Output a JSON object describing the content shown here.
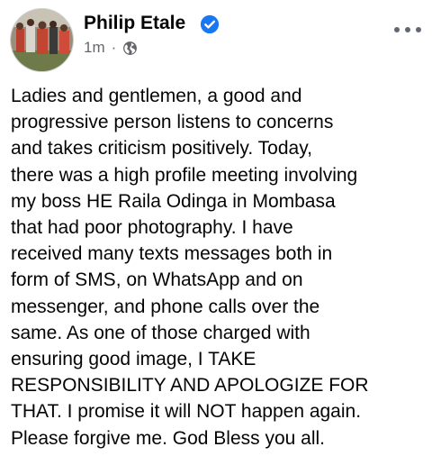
{
  "post": {
    "author": "Philip Etale",
    "time": "1m",
    "separator": "·",
    "audience_icon": "globe-icon",
    "verified_icon": "verified-badge-icon",
    "more_icon": "more-options-icon",
    "colors": {
      "verified": "#1877f2",
      "meta": "#65676b",
      "text": "#050505"
    },
    "text_lines": [
      "Ladies and gentlemen, a good and",
      "progressive person listens to concerns",
      "and takes criticism positively. Today,",
      "there was a high profile meeting involving",
      "my boss HE Raila Odinga in Mombasa",
      "that had poor photography. I have",
      "received many texts messages both in",
      "form of SMS, on WhatsApp and on",
      "messenger, and phone calls over the",
      "same. As one of those charged with",
      "ensuring good image, I TAKE",
      "RESPONSIBILITY AND APOLOGIZE FOR",
      "THAT. I promise it will NOT happen again.",
      "Please forgive me. God Bless you all."
    ]
  }
}
